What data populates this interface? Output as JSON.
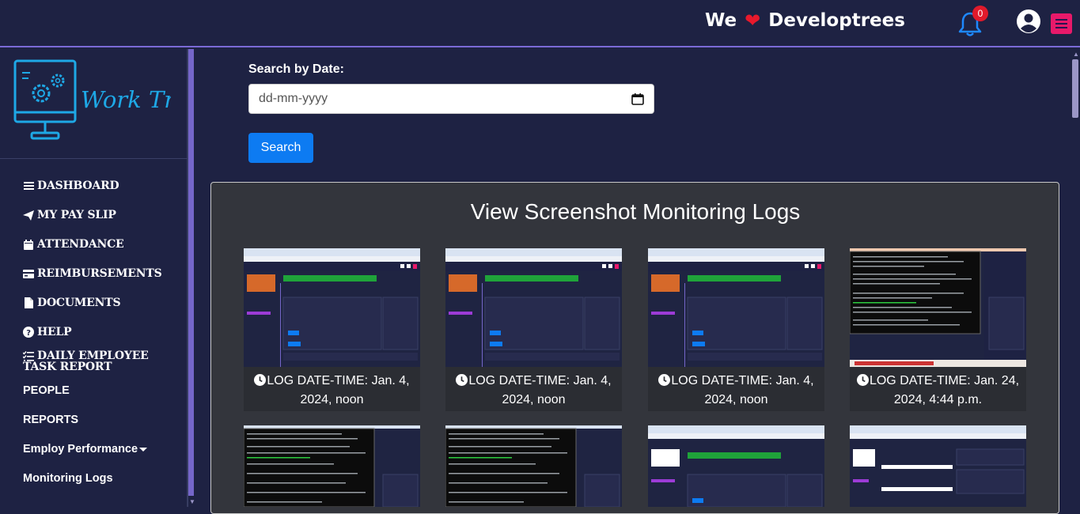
{
  "header": {
    "brand_left": "We",
    "brand_right": "Developtrees",
    "notification_count": "0"
  },
  "sidebar": {
    "logo_text": "Work Tried",
    "items": [
      {
        "label": "DASHBOARD",
        "icon": "bars-icon"
      },
      {
        "label": "MY PAY SLIP",
        "icon": "paper-plane-icon"
      },
      {
        "label": "ATTENDANCE",
        "icon": "calendar-icon"
      },
      {
        "label": "REIMBURSEMENTS",
        "icon": "credit-card-icon"
      },
      {
        "label": "DOCUMENTS",
        "icon": "file-icon"
      },
      {
        "label": "HELP",
        "icon": "question-circle-icon"
      },
      {
        "label": "DAILY EMPLOYEE TASK REPORT",
        "icon": "list-check-icon"
      }
    ],
    "plain_items": [
      "PEOPLE",
      "REPORTS",
      "Employ Performance",
      "Monitoring Logs"
    ]
  },
  "search": {
    "label": "Search by Date:",
    "placeholder": "dd-mm-yyyy",
    "button": "Search"
  },
  "logs": {
    "title": "View Screenshot Monitoring Logs",
    "cards": [
      {
        "caption": "LOG DATE-TIME: Jan. 4, 2024, noon"
      },
      {
        "caption": "LOG DATE-TIME: Jan. 4, 2024, noon"
      },
      {
        "caption": "LOG DATE-TIME: Jan. 4, 2024, noon"
      },
      {
        "caption": "LOG DATE-TIME: Jan. 24, 2024, 4:44 p.m."
      }
    ]
  },
  "colors": {
    "background": "#1e2243",
    "accent_purple": "#7566c9",
    "button_blue": "#0d7bf2",
    "badge_red": "#e01a2b",
    "menu_pink": "#e8196a",
    "logo_cyan": "#1ea8e6"
  }
}
